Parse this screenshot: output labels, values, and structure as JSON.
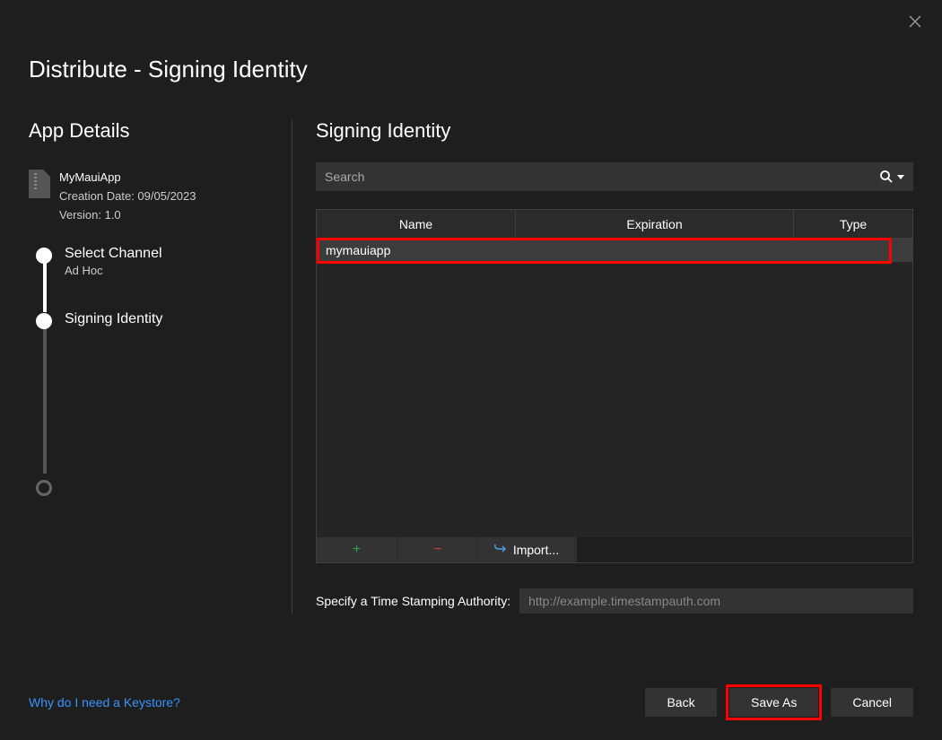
{
  "dialog": {
    "title": "Distribute - Signing Identity"
  },
  "left": {
    "heading": "App Details",
    "app": {
      "name": "MyMauiApp",
      "creation_date": "Creation Date: 09/05/2023",
      "version": "Version: 1.0"
    },
    "steps": {
      "select_channel": {
        "label": "Select Channel",
        "sublabel": "Ad Hoc"
      },
      "signing_identity": {
        "label": "Signing Identity"
      }
    }
  },
  "right": {
    "heading": "Signing Identity",
    "search": {
      "placeholder": "Search"
    },
    "table": {
      "headers": {
        "name": "Name",
        "expiration": "Expiration",
        "type": "Type"
      },
      "rows": [
        {
          "name": "mymauiapp",
          "expiration": "",
          "type": ""
        }
      ]
    },
    "toolbar": {
      "add": "+",
      "remove": "−",
      "import": "Import..."
    },
    "timestamp": {
      "label": "Specify a Time Stamping Authority:",
      "placeholder": "http://example.timestampauth.com"
    }
  },
  "footer": {
    "help_link": "Why do I need a Keystore?",
    "back": "Back",
    "save_as": "Save As",
    "cancel": "Cancel"
  }
}
